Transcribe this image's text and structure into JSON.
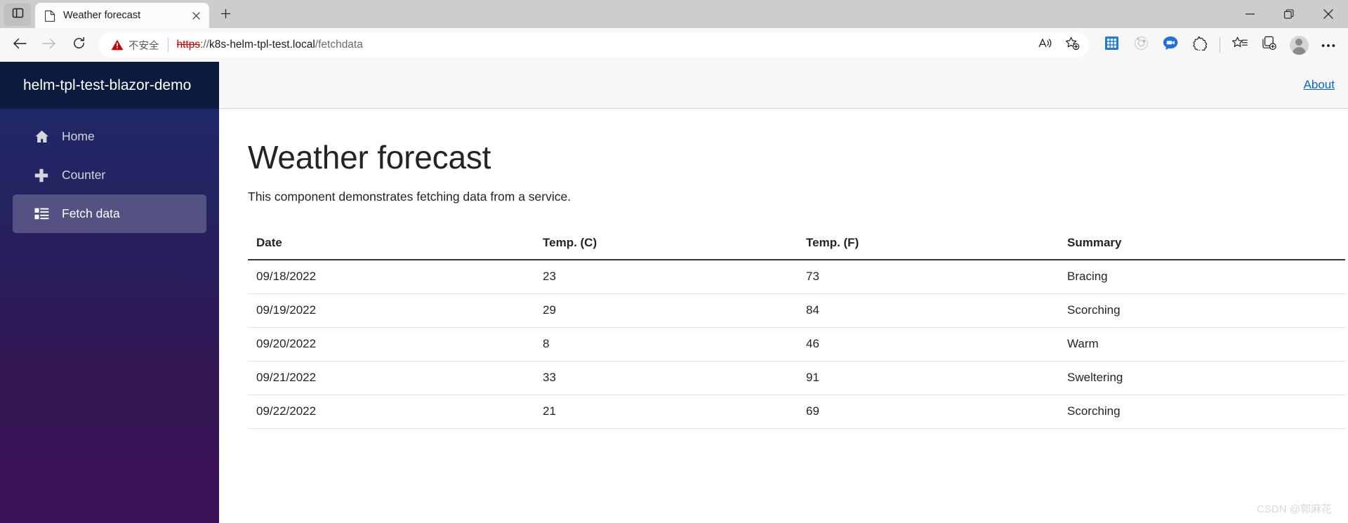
{
  "browser": {
    "tab_actions_icon": "split-panel-icon",
    "tab": {
      "favicon": "page-icon",
      "title": "Weather forecast",
      "close_icon": "close-icon"
    },
    "new_tab_label": "+",
    "window_controls": {
      "minimize": "minimize-icon",
      "restore": "restore-icon",
      "close": "close-icon"
    },
    "nav": {
      "back": "back-arrow-icon",
      "forward": "forward-arrow-icon",
      "reload": "reload-icon"
    },
    "omnibox": {
      "security_icon": "warning-triangle-icon",
      "security_text": "不安全",
      "url_scheme": "https",
      "url_separator": "://",
      "url_host": "k8s-helm-tpl-test.local",
      "url_path": "/fetchdata",
      "read_aloud_icon": "read-aloud-icon",
      "add_favorite_icon": "add-favorite-star-icon"
    },
    "toolbar_right": {
      "apps_icon": "app-grid-icon",
      "discover_icon": "discover-orbit-icon",
      "chat_icon": "video-chat-icon",
      "extensions_icon": "puzzle-piece-icon",
      "favorites_icon": "favorites-star-list-icon",
      "collections_icon": "collections-icon",
      "profile_icon": "profile-avatar-icon",
      "settings_icon": "more-ellipsis-icon"
    }
  },
  "app": {
    "brand": "helm-tpl-test-blazor-demo",
    "nav_items": [
      {
        "label": "Home",
        "icon": "home-icon",
        "active": false
      },
      {
        "label": "Counter",
        "icon": "plus-icon",
        "active": false
      },
      {
        "label": "Fetch data",
        "icon": "list-grid-icon",
        "active": true
      }
    ],
    "topbar": {
      "about_label": "About"
    },
    "main": {
      "title": "Weather forecast",
      "lead": "This component demonstrates fetching data from a service."
    },
    "table": {
      "columns": [
        "Date",
        "Temp. (C)",
        "Temp. (F)",
        "Summary"
      ],
      "rows": [
        {
          "date": "09/18/2022",
          "temp_c": "23",
          "temp_f": "73",
          "summary": "Bracing"
        },
        {
          "date": "09/19/2022",
          "temp_c": "29",
          "temp_f": "84",
          "summary": "Scorching"
        },
        {
          "date": "09/20/2022",
          "temp_c": "8",
          "temp_f": "46",
          "summary": "Warm"
        },
        {
          "date": "09/21/2022",
          "temp_c": "33",
          "temp_f": "91",
          "summary": "Sweltering"
        },
        {
          "date": "09/22/2022",
          "temp_c": "21",
          "temp_f": "69",
          "summary": "Scorching"
        }
      ]
    },
    "watermark": "CSDN @郭麻花"
  },
  "colors": {
    "sidebar_header": "#0d1a40",
    "link": "#0366d6",
    "security_warning": "#cc0000",
    "accent_blue": "#0f7ad6"
  }
}
